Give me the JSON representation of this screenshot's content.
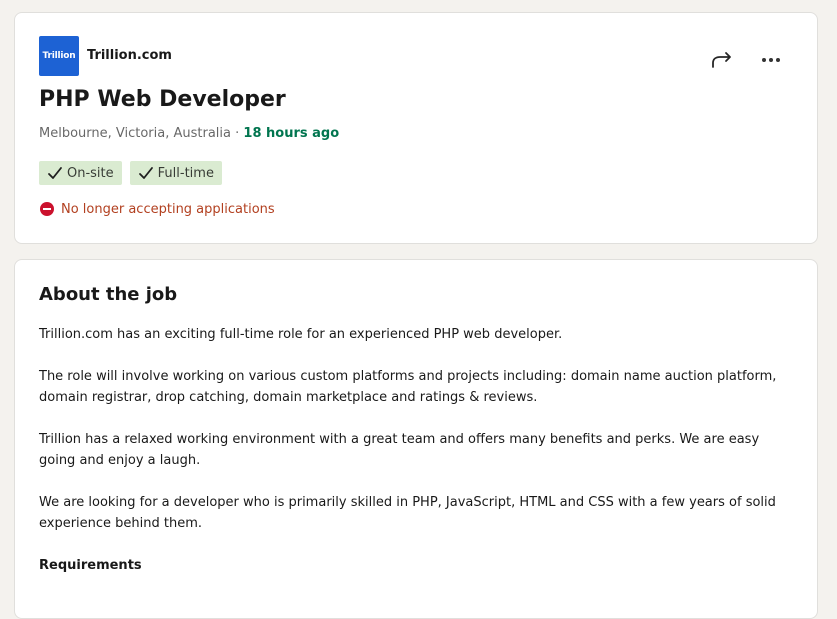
{
  "company": {
    "logo_text": "Trillion",
    "name": "Trillion.com"
  },
  "job": {
    "title": "PHP Web Developer",
    "location": "Melbourne, Victoria, Australia",
    "separator": " · ",
    "posted": "18 hours ago",
    "tags": [
      "On-site",
      "Full-time"
    ],
    "status": "No longer accepting applications"
  },
  "icons": {
    "share": "share-arrow-icon",
    "more": "ellipsis-icon",
    "check": "checkmark-icon",
    "status": "no-entry-icon"
  },
  "colors": {
    "logo_bg": "#1d62d4",
    "posted": "#01754f",
    "chip_bg": "#daebd1",
    "status": "#b24020"
  },
  "about": {
    "title": "About the job",
    "paragraphs": [
      "Trillion.com has an exciting full-time role for an experienced PHP web developer.",
      "The role will involve working on various custom platforms and projects including: domain name auction platform, domain registrar, drop catching, domain marketplace and ratings & reviews.",
      "Trillion has a relaxed working environment with a great team and offers many benefits and perks. We are easy going and enjoy a laugh.",
      "We are looking for a developer who is primarily skilled in PHP, JavaScript, HTML and CSS with a few years of solid experience behind them."
    ],
    "requirements_label": "Requirements"
  }
}
